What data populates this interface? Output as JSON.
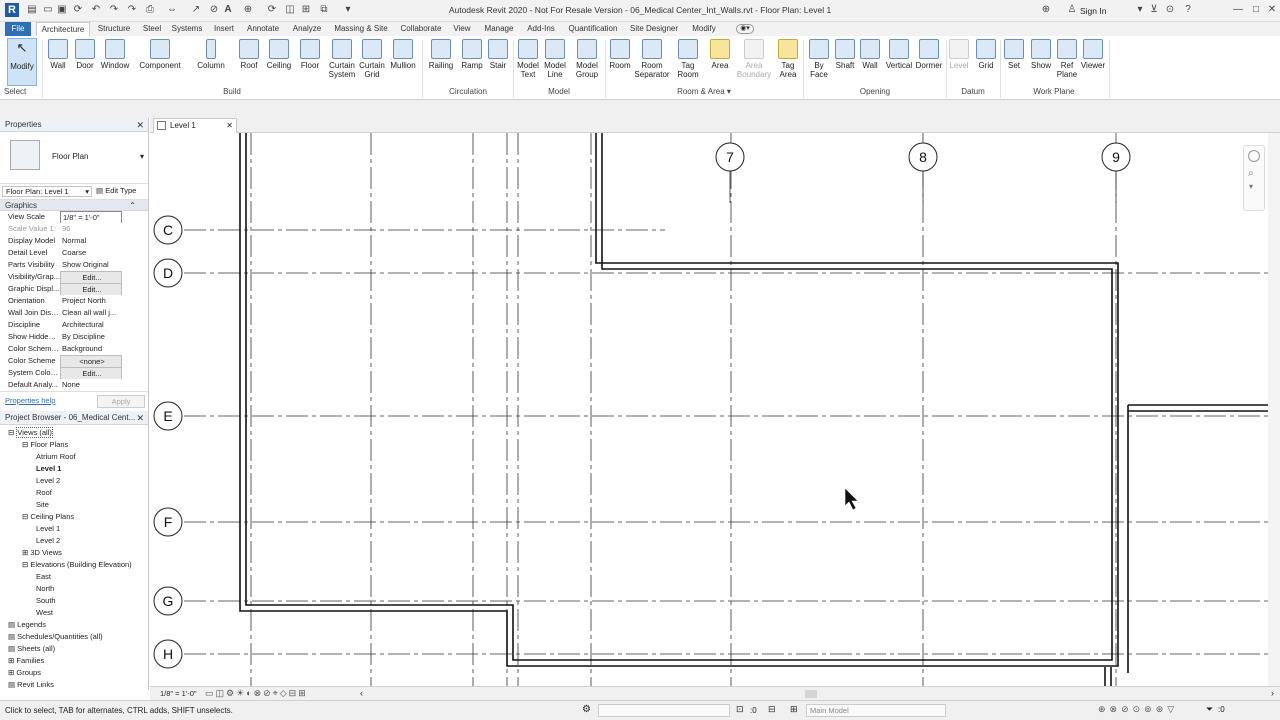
{
  "app": {
    "title": "Autodesk Revit 2020 - Not For Resale Version - 06_Medical Center_Int_Walls.rvt - Floor Plan: Level 1",
    "sign_in": "Sign In"
  },
  "tabs": [
    "File",
    "Architecture",
    "Structure",
    "Steel",
    "Systems",
    "Insert",
    "Annotate",
    "Analyze",
    "Massing & Site",
    "Collaborate",
    "View",
    "Manage",
    "Add-Ins",
    "Quantification",
    "Site Designer",
    "Modify"
  ],
  "ribbon": {
    "select": {
      "label": "Modify",
      "panel": "Select"
    },
    "build": {
      "panel": "Build",
      "tools": [
        "Wall",
        "Door",
        "Window",
        "Component",
        "Column",
        "Roof",
        "Ceiling",
        "Floor",
        "Curtain System",
        "Curtain Grid",
        "Mullion"
      ]
    },
    "circulation": {
      "panel": "Circulation",
      "tools": [
        "Railing",
        "Ramp",
        "Stair"
      ]
    },
    "model": {
      "panel": "Model",
      "tools": [
        "Model Text",
        "Model Line",
        "Model Group"
      ]
    },
    "room_area": {
      "panel": "Room & Area",
      "tools": [
        "Room",
        "Room Separator",
        "Tag Room",
        "Area",
        "Area Boundary",
        "Tag Area"
      ]
    },
    "opening": {
      "panel": "Opening",
      "tools": [
        "By Face",
        "Shaft",
        "Wall",
        "Vertical",
        "Dormer"
      ]
    },
    "datum": {
      "panel": "Datum",
      "tools": [
        "Level",
        "Grid"
      ]
    },
    "work_plane": {
      "panel": "Work Plane",
      "tools": [
        "Set",
        "Show",
        "Ref Plane",
        "Viewer"
      ]
    }
  },
  "properties": {
    "header": "Properties",
    "type": "Floor Plan",
    "instance": "Floor Plan: Level 1",
    "edit_type": "Edit Type",
    "section": "Graphics",
    "rows": [
      {
        "name": "View Scale",
        "value": "1/8\" = 1'-0\""
      },
      {
        "name": "Scale Value    1:",
        "value": "96"
      },
      {
        "name": "Display Model",
        "value": "Normal"
      },
      {
        "name": "Detail Level",
        "value": "Coarse"
      },
      {
        "name": "Parts Visibility",
        "value": "Show Original"
      },
      {
        "name": "Visibility/Grap...",
        "value": "Edit..."
      },
      {
        "name": "Graphic Displ...",
        "value": "Edit..."
      },
      {
        "name": "Orientation",
        "value": "Project North"
      },
      {
        "name": "Wall Join Disp...",
        "value": "Clean all wall j..."
      },
      {
        "name": "Discipline",
        "value": "Architectural"
      },
      {
        "name": "Show Hidden ...",
        "value": "By Discipline"
      },
      {
        "name": "Color Scheme...",
        "value": "Background"
      },
      {
        "name": "Color Scheme",
        "value": "<none>"
      },
      {
        "name": "System Color ...",
        "value": "Edit..."
      },
      {
        "name": "Default Analy...",
        "value": "None"
      }
    ],
    "help": "Properties help",
    "apply": "Apply"
  },
  "browser": {
    "header": "Project Browser - 06_Medical Cent...",
    "items": [
      {
        "label": "Views (all)",
        "level": 0
      },
      {
        "label": "Floor Plans",
        "level": 1
      },
      {
        "label": "Atrium Roof",
        "level": 2
      },
      {
        "label": "Level 1",
        "level": 2,
        "bold": true
      },
      {
        "label": "Level 2",
        "level": 2
      },
      {
        "label": "Roof",
        "level": 2
      },
      {
        "label": "Site",
        "level": 2
      },
      {
        "label": "Ceiling Plans",
        "level": 1
      },
      {
        "label": "Level 1",
        "level": 2
      },
      {
        "label": "Level 2",
        "level": 2
      },
      {
        "label": "3D Views",
        "level": 1
      },
      {
        "label": "Elevations (Building Elevation)",
        "level": 1
      },
      {
        "label": "East",
        "level": 2
      },
      {
        "label": "North",
        "level": 2
      },
      {
        "label": "South",
        "level": 2
      },
      {
        "label": "West",
        "level": 2
      },
      {
        "label": "Legends",
        "level": 0
      },
      {
        "label": "Schedules/Quantities (all)",
        "level": 0
      },
      {
        "label": "Sheets (all)",
        "level": 0
      },
      {
        "label": "Families",
        "level": 0
      },
      {
        "label": "Groups",
        "level": 0
      },
      {
        "label": "Revit Links",
        "level": 0
      }
    ]
  },
  "view_tab": "Level 1",
  "grids": {
    "vertical": [
      "7",
      "8",
      "9"
    ],
    "horizontal": [
      "C",
      "D",
      "E",
      "F",
      "G",
      "H"
    ]
  },
  "view_control": {
    "scale": "1/8\" = 1'-0\""
  },
  "status": {
    "message": "Click to select, TAB for alternates, CTRL adds, SHIFT unselects.",
    "zero": ":0",
    "model": "Main Model"
  },
  "colors": {
    "accent": "#2f6fb5",
    "panel_header": "#eef1f5"
  }
}
